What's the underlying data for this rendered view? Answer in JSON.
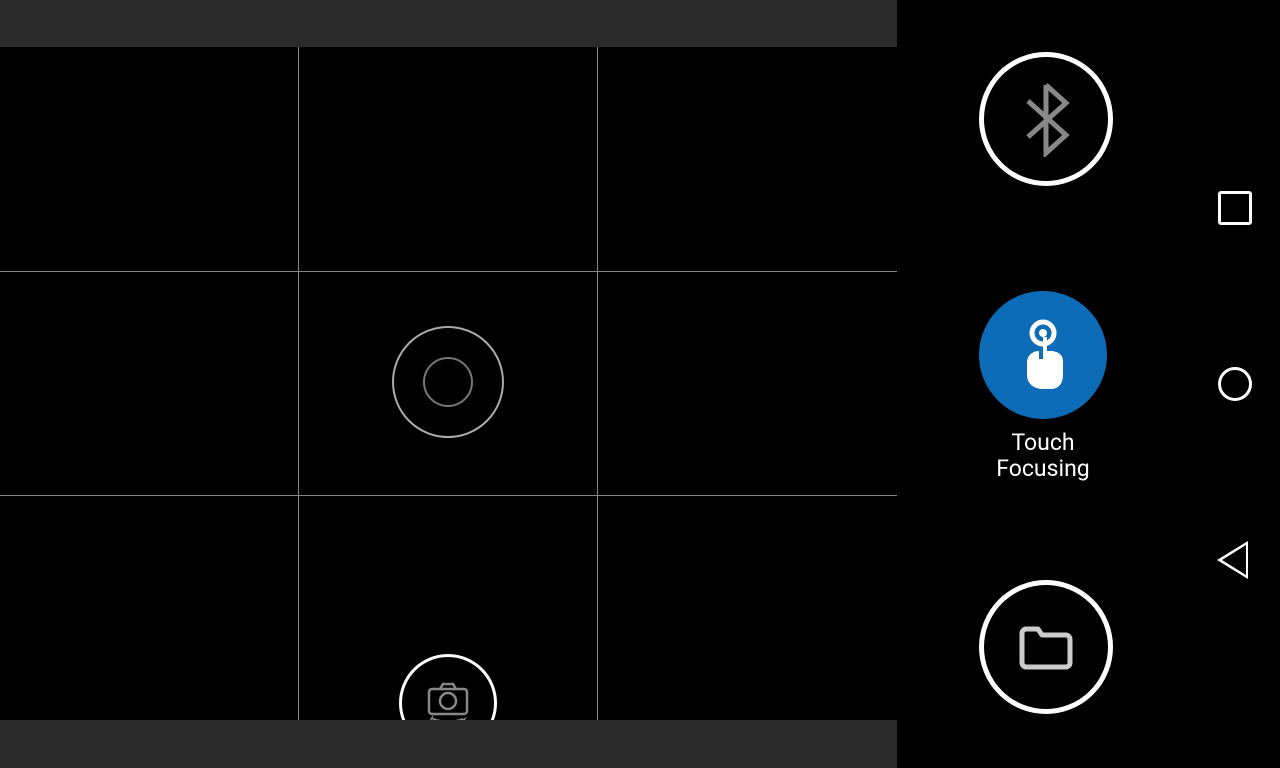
{
  "viewfinder": {
    "grid_enabled": true
  },
  "controls": {
    "bluetooth_label": "Bluetooth",
    "touch_focus_label": "Touch\nFocusing",
    "touch_focus_line1": "Touch",
    "touch_focus_line2": "Focusing",
    "folder_label": "Folder",
    "switch_camera_label": "Switch Camera"
  },
  "colors": {
    "accent": "#0d6cb8",
    "grid": "#888888"
  }
}
